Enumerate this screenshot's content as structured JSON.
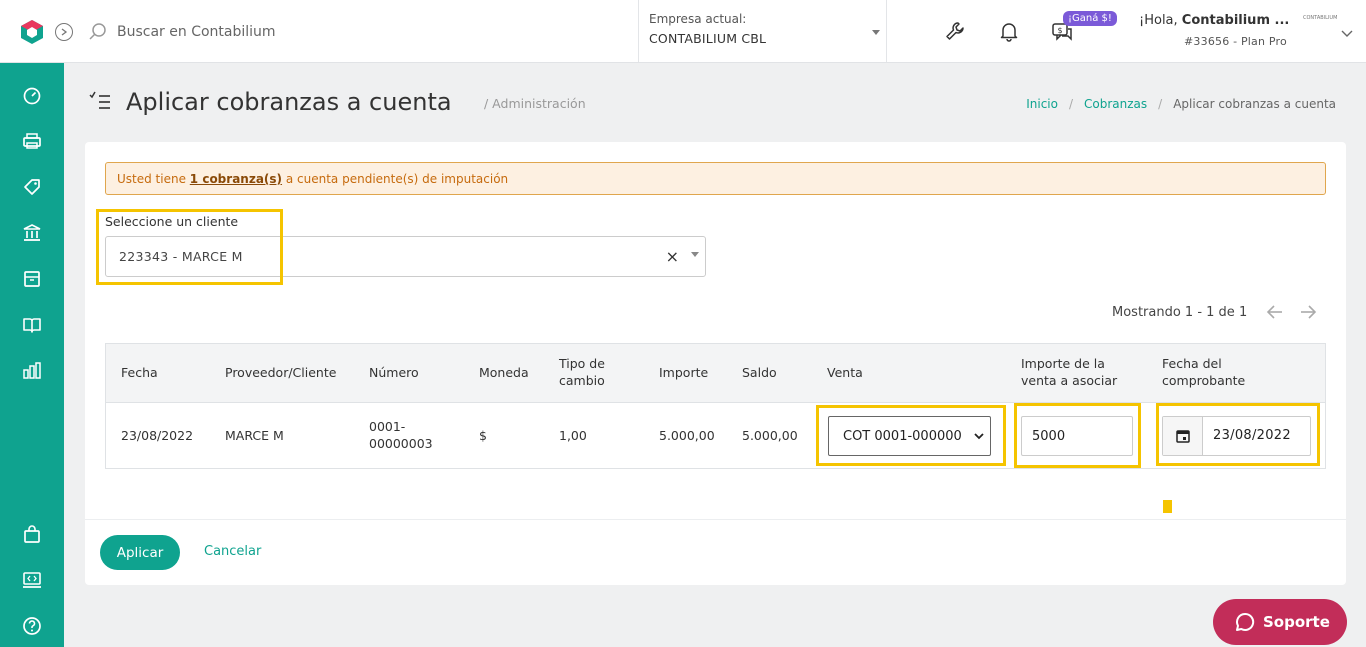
{
  "topbar": {
    "search_placeholder": "Buscar en Contabilium",
    "company_label": "Empresa actual:",
    "company_value": "CONTABILIUM CBL",
    "promo_badge": "¡Ganá $!",
    "greeting_prefix": "¡Hola,",
    "greeting_name": "Contabilium ...",
    "account_plan": "#33656 - Plan Pro",
    "user_logo_text": "CONTABILIUM"
  },
  "sidebar": {
    "items": [
      "dashboard-icon",
      "printer-icon",
      "tag-icon",
      "bank-icon",
      "box-icon",
      "book-icon",
      "chart-icon",
      "bag-icon",
      "code-icon",
      "help-icon"
    ]
  },
  "page": {
    "title": "Aplicar cobranzas a cuenta",
    "subtitle": "/  Administración",
    "breadcrumb": {
      "home": "Inicio",
      "parent": "Cobranzas",
      "current": "Aplicar cobranzas a cuenta"
    }
  },
  "alert": {
    "prefix": "Usted tiene",
    "link": "1 cobranza(s)",
    "suffix": "a cuenta pendiente(s) de imputación"
  },
  "client": {
    "label": "Seleccione un cliente",
    "value": "223343 - MARCE M",
    "clear": "×"
  },
  "pagination": {
    "text": "Mostrando 1 - 1 de 1"
  },
  "table": {
    "headers": {
      "fecha": "Fecha",
      "cliente": "Proveedor/Cliente",
      "numero": "Número",
      "moneda": "Moneda",
      "tipo_cambio_1": "Tipo de",
      "tipo_cambio_2": "cambio",
      "importe": "Importe",
      "saldo": "Saldo",
      "venta": "Venta",
      "importe_venta_1": "Importe de la",
      "importe_venta_2": "venta a asociar",
      "fecha_comp_1": "Fecha del",
      "fecha_comp_2": "comprobante"
    },
    "row": {
      "fecha": "23/08/2022",
      "cliente": "MARCE M",
      "numero_1": "0001-",
      "numero_2": "00000003",
      "moneda": "$",
      "tipo_cambio": "1,00",
      "importe": "5.000,00",
      "saldo": "5.000,00",
      "venta": "COT 0001-000000",
      "importe_venta": "5000",
      "fecha_comprobante": "23/08/2022"
    }
  },
  "actions": {
    "apply": "Aplicar",
    "cancel": "Cancelar"
  },
  "support": {
    "label": "Soporte"
  },
  "colors": {
    "primary": "#0fa38f",
    "highlight": "#f5c400",
    "support": "#c22d59",
    "badge": "#7b5ad8"
  }
}
